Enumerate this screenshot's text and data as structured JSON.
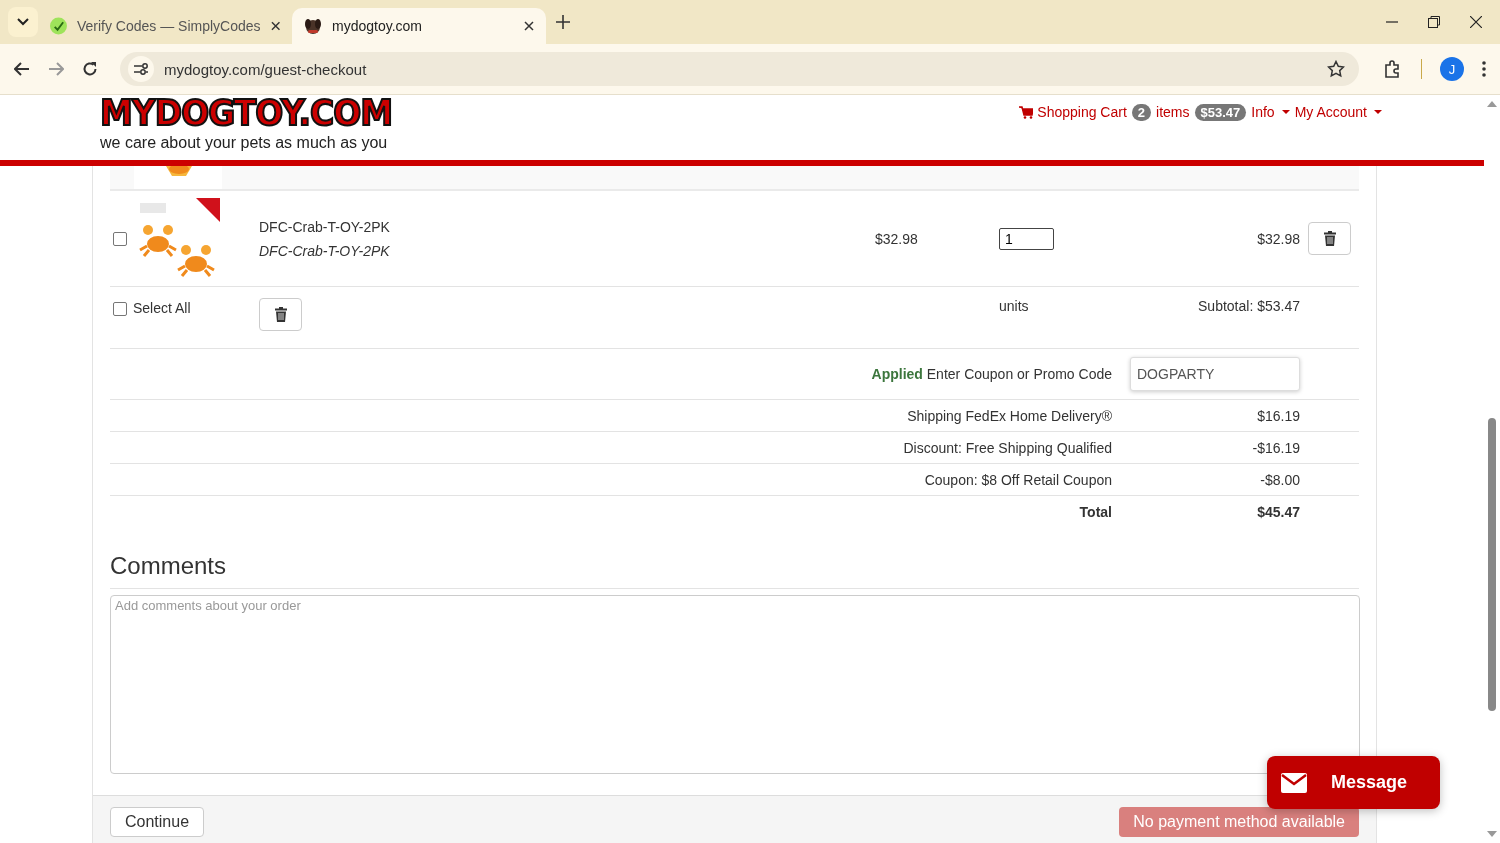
{
  "browser": {
    "tabs": [
      {
        "title": "Verify Codes — SimplyCodes",
        "selected": false
      },
      {
        "title": "mydogtoy.com",
        "selected": true
      }
    ],
    "address": "mydogtoy.com/guest-checkout",
    "profile_initial": "J"
  },
  "header": {
    "logo": "MYDOGTOY.COM",
    "tagline": "we care about your pets as much as you",
    "nav": {
      "cart_label": "Shopping Cart",
      "item_count": "2",
      "items_label": "items",
      "cart_total": "$53.47",
      "menus": [
        "Info",
        "My Account"
      ]
    }
  },
  "cart": {
    "items": [
      {
        "kind": "partial"
      },
      {
        "kind": "product",
        "name": "DFC-Crab-T-OY-2PK",
        "sku": "DFC-Crab-T-OY-2PK",
        "price": "$32.98",
        "quantity": "1",
        "line_total": "$32.98",
        "checked": false
      }
    ],
    "select_all": {
      "label": "Select All",
      "checked": false
    },
    "units_label": "units",
    "subtotal": "Subtotal: $53.47"
  },
  "coupon": {
    "status": "Applied",
    "label": "Enter Coupon or Promo Code",
    "value": "DOGPARTY"
  },
  "summary": [
    {
      "label": "Shipping FedEx Home Delivery®",
      "amount": "$16.19",
      "bold": false
    },
    {
      "label": "Discount: Free Shipping Qualified",
      "amount": "-$16.19",
      "bold": false
    },
    {
      "label": "Coupon: $8 Off Retail Coupon",
      "amount": "-$8.00",
      "bold": false
    },
    {
      "label": "Total",
      "amount": "$45.47",
      "bold": true
    }
  ],
  "comments": {
    "heading": "Comments",
    "placeholder": "Add comments about your order"
  },
  "buttons": {
    "continue": "Continue",
    "payment": {
      "label": "No payment method available",
      "disabled": true
    }
  },
  "chat": {
    "label": "Message"
  }
}
